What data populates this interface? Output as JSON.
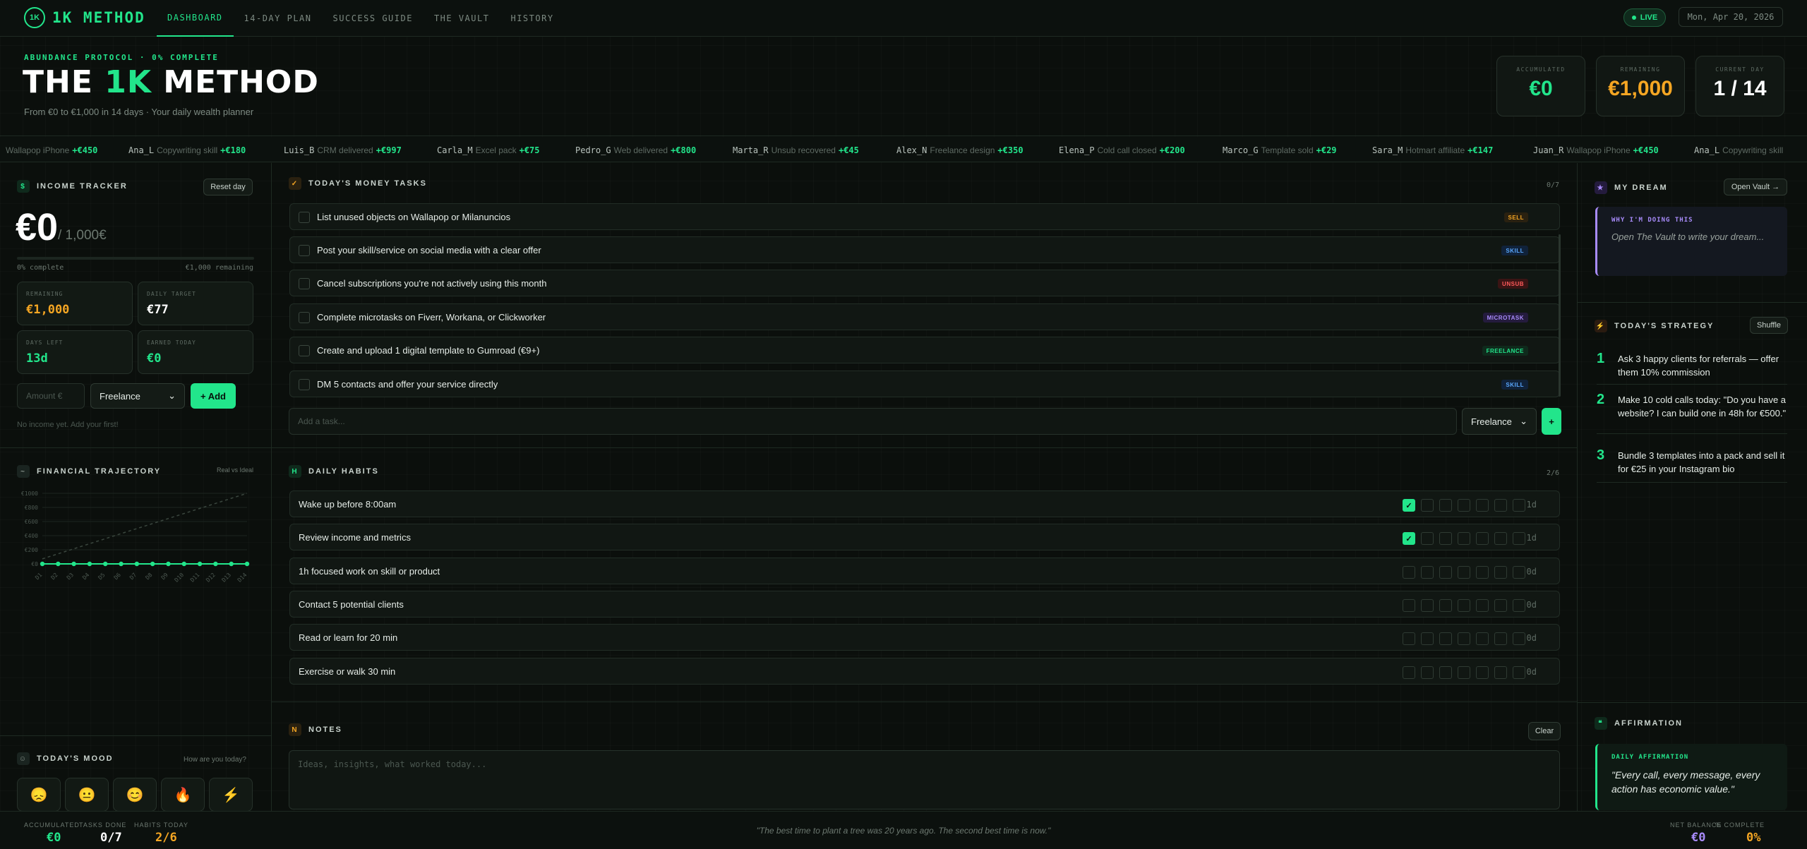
{
  "nav": {
    "logo_mark": "1K",
    "logo_text": "1K METHOD",
    "tabs": [
      "DASHBOARD",
      "14-DAY PLAN",
      "SUCCESS GUIDE",
      "THE VAULT",
      "HISTORY"
    ],
    "live": "LIVE",
    "date": "Mon, Apr 20, 2026"
  },
  "header": {
    "kicker": "ABUNDANCE PROTOCOL · 0% COMPLETE",
    "title_pre": "THE ",
    "title_accent": "1K",
    "title_post": " METHOD",
    "subtitle": "From €0 to €1,000 in 14 days · Your daily wealth planner",
    "stats": [
      {
        "label": "ACCUMULATED",
        "value": "€0"
      },
      {
        "label": "REMAINING",
        "value": "€1,000"
      },
      {
        "label": "CURRENT DAY",
        "value": "1 / 14"
      }
    ]
  },
  "ticker": [
    {
      "name": "",
      "desc": "Wallapop iPhone",
      "amount": "+€450"
    },
    {
      "name": "Ana_L",
      "desc": "Copywriting skill",
      "amount": "+€180"
    },
    {
      "name": "Luis_B",
      "desc": "CRM delivered",
      "amount": "+€997"
    },
    {
      "name": "Carla_M",
      "desc": "Excel pack",
      "amount": "+€75"
    },
    {
      "name": "Pedro_G",
      "desc": "Web delivered",
      "amount": "+€800"
    },
    {
      "name": "Marta_R",
      "desc": "Unsub recovered",
      "amount": "+€45"
    },
    {
      "name": "Alex_N",
      "desc": "Freelance design",
      "amount": "+€350"
    },
    {
      "name": "Elena_P",
      "desc": "Cold call closed",
      "amount": "+€200"
    },
    {
      "name": "Marco_G",
      "desc": "Template sold",
      "amount": "+€29"
    },
    {
      "name": "Sara_M",
      "desc": "Hotmart affiliate",
      "amount": "+€147"
    },
    {
      "name": "Juan_R",
      "desc": "Wallapop iPhone",
      "amount": "+€450"
    },
    {
      "name": "Ana_L",
      "desc": "Copywriting skill",
      "amount": ""
    }
  ],
  "income": {
    "title": "INCOME TRACKER",
    "icon": "$",
    "reset": "Reset day",
    "amount": "€0",
    "target": "/ 1,000€",
    "progress": 0,
    "progress_left": "0% complete",
    "progress_right": "€1,000 remaining",
    "cards": [
      {
        "label": "REMAINING",
        "value": "€1,000"
      },
      {
        "label": "DAILY TARGET",
        "value": "€77"
      },
      {
        "label": "DAYS LEFT",
        "value": "13d"
      },
      {
        "label": "EARNED TODAY",
        "value": "€0"
      }
    ],
    "amount_placeholder": "Amount €",
    "category": "Freelance",
    "add": "+ Add",
    "empty": "No income yet. Add your first!"
  },
  "trajectory": {
    "title": "FINANCIAL TRAJECTORY",
    "icon": "~",
    "legend": "Real vs Ideal"
  },
  "chart_data": {
    "type": "line",
    "x": [
      "D1",
      "D2",
      "D3",
      "D4",
      "D5",
      "D6",
      "D7",
      "D8",
      "D9",
      "D10",
      "D11",
      "D12",
      "D13",
      "D14"
    ],
    "yticks": [
      "€0",
      "€200",
      "€400",
      "€600",
      "€800",
      "€1000"
    ],
    "ylim": [
      0,
      1000
    ],
    "series": [
      {
        "values": [
          0,
          0,
          0,
          0,
          0,
          0,
          0,
          0,
          0,
          0,
          0,
          0,
          0,
          0
        ],
        "color": "#22e58b"
      },
      {
        "values": [
          71,
          143,
          214,
          286,
          357,
          429,
          500,
          571,
          643,
          714,
          786,
          857,
          929,
          1000
        ],
        "color": "#3a463e"
      }
    ]
  },
  "mood": {
    "title": "TODAY'S MOOD",
    "icon": "☺",
    "prompt": "How are you today?",
    "faces": [
      "😞",
      "😐",
      "😊",
      "🔥",
      "⚡"
    ]
  },
  "tasks": {
    "title": "TODAY'S MONEY TASKS",
    "icon": "✓",
    "count": "0/7",
    "items": [
      {
        "text": "List unused objects on Wallapop or Milanuncios",
        "badge": "SELL",
        "color": "#f5a623",
        "bg": "#2a2110"
      },
      {
        "text": "Post your skill/service on social media with a clear offer",
        "badge": "SKILL",
        "color": "#5aa9ff",
        "bg": "#10223a"
      },
      {
        "text": "Cancel subscriptions you're not actively using this month",
        "badge": "UNSUB",
        "color": "#ff5a5a",
        "bg": "#3a1414"
      },
      {
        "text": "Complete microtasks on Fiverr, Workana, or Clickworker",
        "badge": "MICROTASK",
        "color": "#a88bfa",
        "bg": "#241b3d"
      },
      {
        "text": "Create and upload 1 digital template to Gumroad (€9+)",
        "badge": "FREELANCE",
        "color": "#22e58b",
        "bg": "#0f2a1c"
      },
      {
        "text": "DM 5 contacts and offer your service directly",
        "badge": "SKILL",
        "color": "#5aa9ff",
        "bg": "#10223a"
      }
    ],
    "add_placeholder": "Add a task...",
    "category": "Freelance",
    "add": "+"
  },
  "habits": {
    "title": "DAILY HABITS",
    "icon": "H",
    "count": "2/6",
    "items": [
      {
        "text": "Wake up before 8:00am",
        "done": 1,
        "streak": "1d"
      },
      {
        "text": "Review income and metrics",
        "done": 1,
        "streak": "1d"
      },
      {
        "text": "1h focused work on skill or product",
        "done": 0,
        "streak": "0d"
      },
      {
        "text": "Contact 5 potential clients",
        "done": 0,
        "streak": "0d"
      },
      {
        "text": "Read or learn for 20 min",
        "done": 0,
        "streak": "0d"
      },
      {
        "text": "Exercise or walk 30 min",
        "done": 0,
        "streak": "0d"
      }
    ]
  },
  "notes": {
    "title": "NOTES",
    "icon": "N",
    "clear": "Clear",
    "placeholder": "Ideas, insights, what worked today..."
  },
  "dream": {
    "title": "MY DREAM",
    "icon": "★",
    "open": "Open Vault →",
    "kicker": "WHY I'M DOING THIS",
    "text": "Open The Vault to write your dream..."
  },
  "strategy": {
    "title": "TODAY'S STRATEGY",
    "icon": "⚡",
    "shuffle": "Shuffle",
    "items": [
      {
        "n": "1",
        "text": "Ask 3 happy clients for referrals — offer them 10% commission"
      },
      {
        "n": "2",
        "text": "Make 10 cold calls today: \"Do you have a website? I can build one in 48h for €500.\""
      },
      {
        "n": "3",
        "text": "Bundle 3 templates into a pack and sell it for €25 in your Instagram bio"
      }
    ]
  },
  "affirmation": {
    "title": "AFFIRMATION",
    "icon": "❝",
    "kicker": "DAILY AFFIRMATION",
    "text": "\"Every call, every message, every action has economic value.\""
  },
  "footer": {
    "l1": "ACCUMULATED",
    "v1": "€0",
    "l2": "TASKS DONE",
    "v2": "0/7",
    "l3": "HABITS TODAY",
    "v3": "2/6",
    "quote": "\"The best time to plant a tree was 20 years ago. The second best time is now.\"",
    "l4": "NET BALANCE",
    "v4": "€0",
    "l5": "% COMPLETE",
    "v5": "0%"
  }
}
